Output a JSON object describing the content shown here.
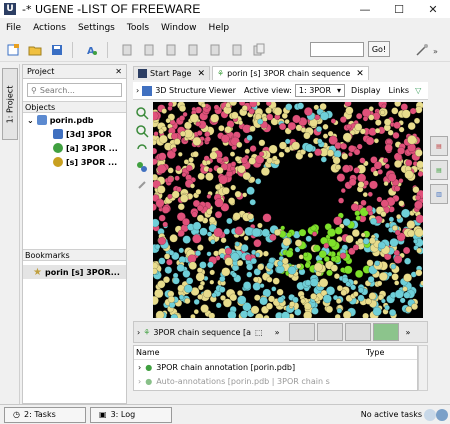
{
  "window": {
    "title_app": "-* UGENE",
    "title_caption": "-LIST OF FREEWARE",
    "minimize": "—",
    "maximize": "☐",
    "close": "✕"
  },
  "menu": [
    "File",
    "Actions",
    "Settings",
    "Tools",
    "Window",
    "Help"
  ],
  "toolbar": {
    "go_label": "Go!",
    "search_value": ""
  },
  "left_tab": {
    "label": "1: Project"
  },
  "project": {
    "header": "Project",
    "close": "✕",
    "search_placeholder": "Search...",
    "objects_label": "Objects",
    "document": "porin.pdb",
    "items": [
      "[3d] 3POR",
      "[a] 3POR ...",
      "[s] 3POR ..."
    ],
    "bookmarks_label": "Bookmarks",
    "bookmark": "porin [s] 3POR..."
  },
  "editor_tabs": [
    {
      "label": "Start Page",
      "close": "✕"
    },
    {
      "label": "porin [s] 3POR chain  sequence",
      "close": "✕"
    }
  ],
  "view_bar": {
    "viewer_label": "3D Structure Viewer",
    "active_view_label": "Active view:",
    "active_view_value": "1: 3POR",
    "display_label": "Display",
    "links_label": "Links"
  },
  "sequence_bar": {
    "label": "3POR chain  sequence [a",
    "more": "»"
  },
  "annotations": {
    "col_name": "Name",
    "col_type": "Type",
    "rows": [
      "3POR chain  annotation [porin.pdb]",
      "Auto-annotations [porin.pdb | 3POR chain  s"
    ]
  },
  "status": {
    "tasks_button": "2: Tasks",
    "log_button": "3: Log",
    "active_tasks": "No active tasks"
  },
  "colors": {
    "pink": "#e0517a",
    "yellow": "#e8dc8c",
    "cyan": "#6ecfd8",
    "green": "#7ee02a",
    "background": "#000000"
  }
}
